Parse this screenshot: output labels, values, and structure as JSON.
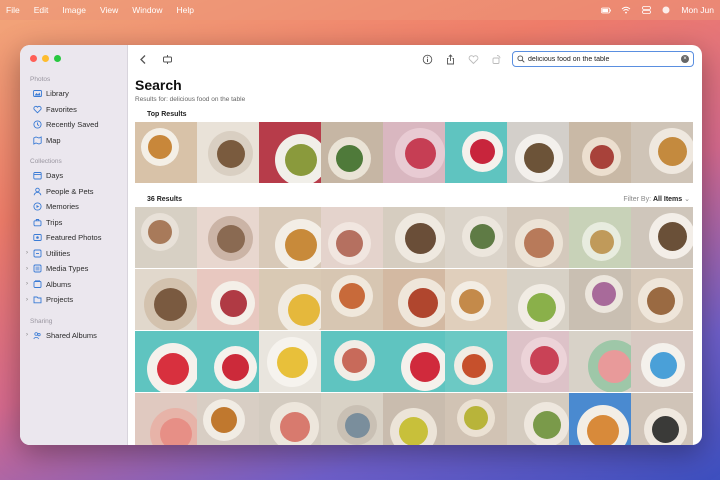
{
  "menubar": {
    "items": [
      "File",
      "Edit",
      "Image",
      "View",
      "Window",
      "Help"
    ],
    "clock": "Mon Jun"
  },
  "sidebar": {
    "photos_header": "Photos",
    "library": "Library",
    "favorites": "Favorites",
    "recently_saved": "Recently Saved",
    "map": "Map",
    "collections_header": "Collections",
    "days": "Days",
    "people_pets": "People & Pets",
    "memories": "Memories",
    "trips": "Trips",
    "featured_photos": "Featured Photos",
    "utilities": "Utilities",
    "media_types": "Media Types",
    "albums": "Albums",
    "projects": "Projects",
    "sharing_header": "Sharing",
    "shared_albums": "Shared Albums"
  },
  "search": {
    "value": "delicious food on the table"
  },
  "main": {
    "title": "Search",
    "subtitle": "Results for: delicious food on the table",
    "top_results_label": "Top Results",
    "results_count": "36 Results",
    "filter_label": "Filter By:",
    "filter_value": "All Items"
  },
  "colors": {
    "accent": "#5a8fe0",
    "sidebar_bg": "#ebe7ee"
  },
  "photos_top": [
    {
      "bg": "#d8c2a8",
      "plate": "#f4efe6",
      "food": "#c8873a"
    },
    {
      "bg": "#e9e2d8",
      "plate": "#d9cfc2",
      "food": "#7a5b3e"
    },
    {
      "bg": "#b73c4a",
      "plate": "#f1efe9",
      "food": "#8a9a3c"
    },
    {
      "bg": "#c6b6a4",
      "plate": "#eae3d6",
      "food": "#4f7a3a"
    },
    {
      "bg": "#d9b7c0",
      "plate": "#e8cbd3",
      "food": "#c63e54"
    },
    {
      "bg": "#5fc4c0",
      "plate": "#f5f1ec",
      "food": "#c8253c"
    },
    {
      "bg": "#d3cfca",
      "plate": "#f3f0ec",
      "food": "#6c5338"
    },
    {
      "bg": "#c9b9a6",
      "plate": "#ecdfcf",
      "food": "#a8423a"
    },
    {
      "bg": "#cfc4b7",
      "plate": "#efe8df",
      "food": "#c48a3e"
    }
  ],
  "photos_results": [
    {
      "bg": "#d7d0c4",
      "plate": "#e8e1d8",
      "food": "#a87a5a"
    },
    {
      "bg": "#e8d7cf",
      "plate": "#cbb4a6",
      "food": "#8a6a52"
    },
    {
      "bg": "#d8c9b8",
      "plate": "#f3eee6",
      "food": "#c88a3a"
    },
    {
      "bg": "#e4d3cc",
      "plate": "#f1e6e0",
      "food": "#b57060"
    },
    {
      "bg": "#d6cdc0",
      "plate": "#efe9e0",
      "food": "#6a4e38"
    },
    {
      "bg": "#dbd4ca",
      "plate": "#ece6dd",
      "food": "#5f7b45"
    },
    {
      "bg": "#d4c9bc",
      "plate": "#ece3d6",
      "food": "#b87a5a"
    },
    {
      "bg": "#c8d2b8",
      "plate": "#e8ecdf",
      "food": "#c09a5a"
    },
    {
      "bg": "#cfc6bb",
      "plate": "#f3eee8",
      "food": "#6a5038"
    },
    {
      "bg": "#e1d8cc",
      "plate": "#d3c2ae",
      "food": "#7a5a40"
    },
    {
      "bg": "#e8c8c0",
      "plate": "#f4efe8",
      "food": "#b03a44"
    },
    {
      "bg": "#d9c9b4",
      "plate": "#f1ebe2",
      "food": "#e5b83c"
    },
    {
      "bg": "#d7c6b2",
      "plate": "#f0e8dc",
      "food": "#c86a3a"
    },
    {
      "bg": "#d3b9a2",
      "plate": "#efe6da",
      "food": "#b0462e"
    },
    {
      "bg": "#e0cfbc",
      "plate": "#f3ede4",
      "food": "#c48a4a"
    },
    {
      "bg": "#d7d1c6",
      "plate": "#f1ece4",
      "food": "#8ab04a"
    },
    {
      "bg": "#c9bfb2",
      "plate": "#ece6dd",
      "food": "#a86a9a"
    },
    {
      "bg": "#d6c8b8",
      "plate": "#efe6da",
      "food": "#9a6a42"
    },
    {
      "bg": "#5fc4c0",
      "plate": "#f5f1ec",
      "food": "#d8303e"
    },
    {
      "bg": "#5fc4c0",
      "plate": "#f5f1ec",
      "food": "#cc2a3a"
    },
    {
      "bg": "#e9e5de",
      "plate": "#f6f3ee",
      "food": "#e8c03a"
    },
    {
      "bg": "#5fc4c0",
      "plate": "#f2ede6",
      "food": "#c86a5a"
    },
    {
      "bg": "#5fc4c0",
      "plate": "#f5f1ec",
      "food": "#d02a3c"
    },
    {
      "bg": "#6cc9c4",
      "plate": "#f1ece4",
      "food": "#c6502c"
    },
    {
      "bg": "#ddc2c8",
      "plate": "#ecd3d8",
      "food": "#c94256"
    },
    {
      "bg": "#d8d2c8",
      "plate": "#9ec7a8",
      "food": "#e89a9a"
    },
    {
      "bg": "#d8c9c2",
      "plate": "#f4f1ec",
      "food": "#4aa0d8"
    },
    {
      "bg": "#e0c9c0",
      "plate": "#e7b3a8",
      "food": "#e78f86"
    },
    {
      "bg": "#d8cec4",
      "plate": "#f1ece4",
      "food": "#c0782e"
    },
    {
      "bg": "#d3cbc0",
      "plate": "#ede6dc",
      "food": "#d87a6e"
    },
    {
      "bg": "#d9d2c6",
      "plate": "#c9c0b4",
      "food": "#7a8e9c"
    },
    {
      "bg": "#c9bcae",
      "plate": "#ece4d8",
      "food": "#c8c03a"
    },
    {
      "bg": "#d1c3b4",
      "plate": "#ebe1d3",
      "food": "#b8b43a"
    },
    {
      "bg": "#d5ccc0",
      "plate": "#eee7de",
      "food": "#7a9a4a"
    },
    {
      "bg": "#4a8ad0",
      "plate": "#f3eee6",
      "food": "#d88a3a"
    },
    {
      "bg": "#d0c4b8",
      "plate": "#efe8df",
      "food": "#3a3a38"
    }
  ]
}
